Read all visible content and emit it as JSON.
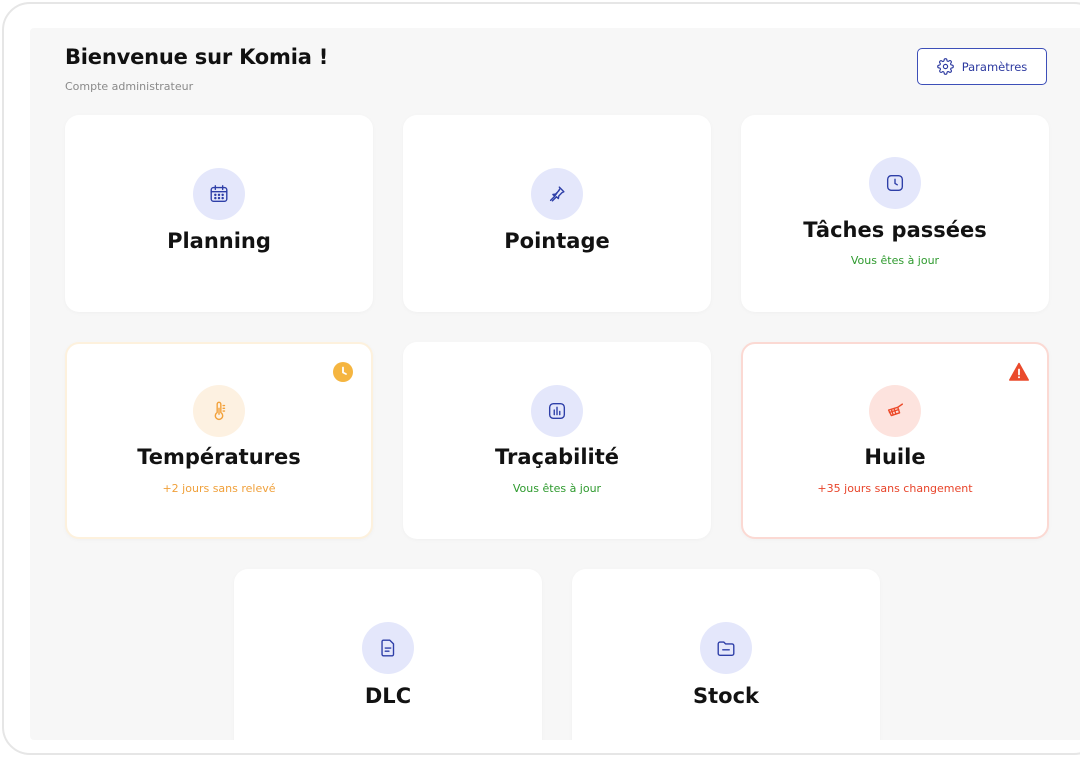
{
  "header": {
    "title": "Bienvenue sur Komia !",
    "subtitle": "Compte administrateur",
    "settings_label": "Paramètres",
    "settings_icon": "gear-icon"
  },
  "cards": [
    {
      "title": "Planning",
      "icon": "calendar-icon",
      "status": "",
      "tone": "blue"
    },
    {
      "title": "Pointage",
      "icon": "pin-icon",
      "status": "",
      "tone": "blue"
    },
    {
      "title": "Tâches passées",
      "icon": "clock-icon",
      "status": "Vous êtes à jour",
      "tone": "blue"
    },
    {
      "title": "Températures",
      "icon": "thermometer-icon",
      "status": "+2 jours sans relevé",
      "tone": "orange",
      "badge": "clock-badge-icon"
    },
    {
      "title": "Traçabilité",
      "icon": "bar-chart-icon",
      "status": "Vous êtes à jour",
      "tone": "blue"
    },
    {
      "title": "Huile",
      "icon": "fryer-basket-icon",
      "status": "+35 jours sans changement",
      "tone": "red",
      "badge": "warning-icon"
    },
    {
      "title": "DLC",
      "icon": "document-icon",
      "status": "",
      "tone": "blue"
    },
    {
      "title": "Stock",
      "icon": "folder-icon",
      "status": "",
      "tone": "blue"
    }
  ],
  "colors": {
    "accent": "#2e3fa8",
    "accent_bg": "#e4e7fb",
    "ok": "#2e9a2e",
    "warn": "#f0a03a",
    "danger": "#e8442a",
    "background": "#f7f7f7"
  }
}
